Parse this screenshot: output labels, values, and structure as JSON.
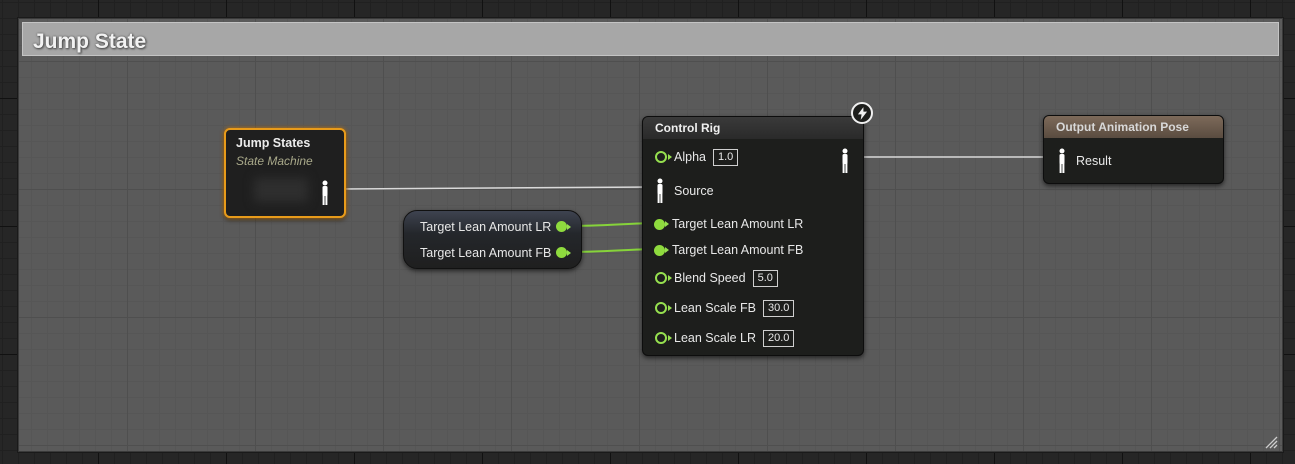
{
  "comment": {
    "title": "Jump State"
  },
  "state_machine_node": {
    "title": "Jump States",
    "subtitle": "State Machine"
  },
  "variables_node": {
    "outputs": [
      "Target Lean Amount LR",
      "Target Lean Amount FB"
    ]
  },
  "control_rig_node": {
    "title": "Control Rig",
    "pins": [
      {
        "label": "Alpha",
        "value": "1.0",
        "type": "float"
      },
      {
        "label": "Source",
        "type": "pose"
      },
      {
        "label": "Target Lean Amount LR",
        "type": "float-connected"
      },
      {
        "label": "Target Lean Amount FB",
        "type": "float-connected"
      },
      {
        "label": "Blend Speed",
        "value": "5.0",
        "type": "float"
      },
      {
        "label": "Lean Scale FB",
        "value": "30.0",
        "type": "float"
      },
      {
        "label": "Lean Scale LR",
        "value": "20.0",
        "type": "float"
      }
    ],
    "badge_icon": "lightning-icon"
  },
  "output_node": {
    "title": "Output Animation Pose",
    "pin_label": "Result"
  },
  "colors": {
    "float_pin": "#8fdb3e",
    "selection_outline": "#e89b1a",
    "pose_wire": "#d9d9d9",
    "float_wire": "#86d33a"
  }
}
